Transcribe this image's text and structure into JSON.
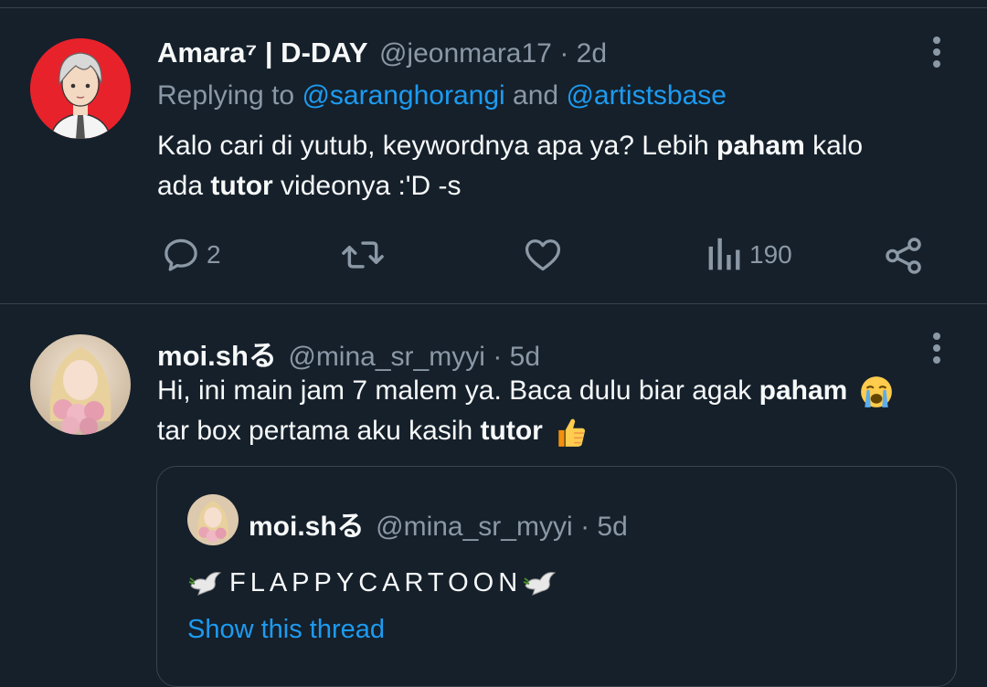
{
  "tweet1": {
    "name": "Amara⁷ | D-DAY",
    "handle": "@jeonmara17",
    "time": "· 2d",
    "replying_prefix": "Replying to ",
    "replying_user1": "@saranghorangi",
    "replying_and": " and ",
    "replying_user2": "@artistsbase",
    "text_line1_a": "Kalo cari di yutub, keywordnya apa ya? Lebih ",
    "text_line1_bold": "paham",
    "text_line1_b": " kalo",
    "text_line2_a": "ada ",
    "text_line2_bold": "tutor",
    "text_line2_b": " videonya :'D -s",
    "reply_count": "2",
    "view_count": "190",
    "icons": [
      "reply-icon",
      "retweet-icon",
      "like-icon",
      "views-icon",
      "share-icon",
      "more-icon"
    ]
  },
  "tweet2": {
    "name": "moi.shる",
    "handle": "@mina_sr_myyi",
    "time": "· 5d",
    "text_line1_a": "Hi, ini main jam 7 malem ya. Baca dulu biar agak ",
    "text_line1_bold": "paham",
    "text_line2_a": "tar box pertama aku kasih ",
    "text_line2_bold": "tutor",
    "quote": {
      "name": "moi.shる",
      "handle": "@mina_sr_myyi",
      "time": "· 5d",
      "text": "FLAPPYCARTOON",
      "show_thread": "Show this thread"
    }
  },
  "colors": {
    "background": "#15202b",
    "text_primary": "#f7f9f9",
    "text_secondary": "#8b98a5",
    "link": "#1d9bf0",
    "border": "#38444d"
  }
}
